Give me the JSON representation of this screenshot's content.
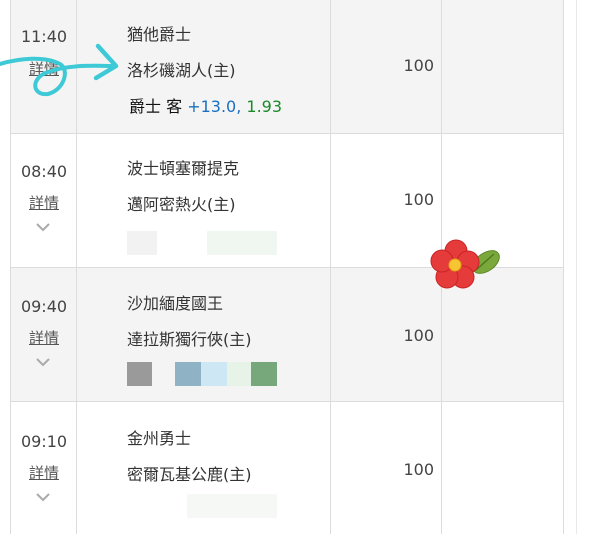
{
  "detail_label": "詳情",
  "games": [
    {
      "time": "11:40",
      "away": "猶他爵士",
      "home": "洛杉磯湖人(主)",
      "odds": "100",
      "bet": {
        "team": "爵士 客",
        "handicap": "+13.0,",
        "price": "1.93"
      }
    },
    {
      "time": "08:40",
      "away": "波士頓塞爾提克",
      "home": "邁阿密熱火(主)",
      "odds": "100"
    },
    {
      "time": "09:40",
      "away": "沙加緬度國王",
      "home": "達拉斯獨行俠(主)",
      "odds": "100",
      "swatches": [
        "#9a9a9a",
        "#8fb3c4",
        "#cde8f4",
        "#e6f3e6",
        "#76a87c"
      ]
    },
    {
      "time": "09:10",
      "away": "金州勇士",
      "home": "密爾瓦基公鹿(主)",
      "odds": "100"
    }
  ],
  "colors": {
    "arrow": "#3ec9d6",
    "flower": "#e63b3b",
    "leaf": "#7aa83a",
    "handicap": "#1a6fc0",
    "price": "#1a8a2a"
  }
}
